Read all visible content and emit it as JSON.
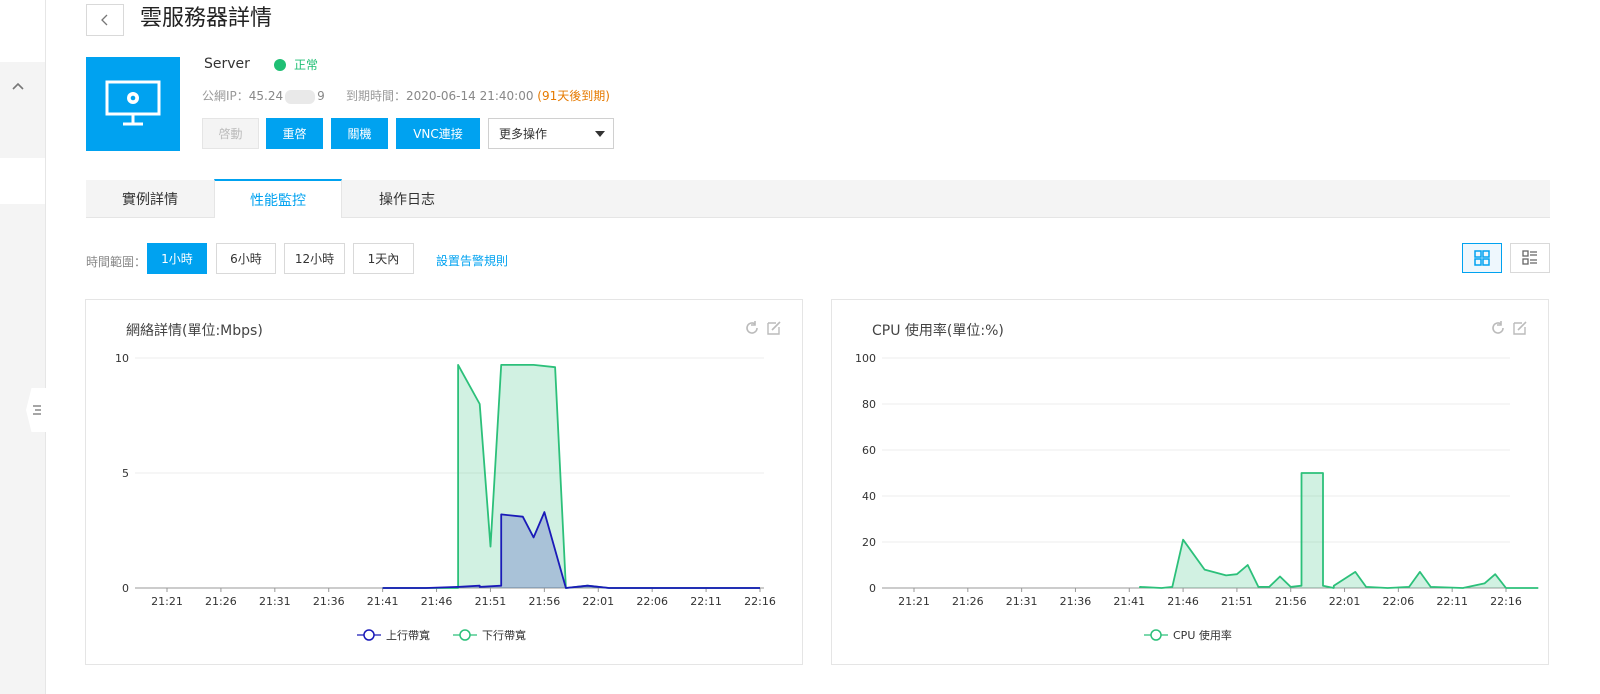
{
  "page": {
    "title": "雲服務器詳情"
  },
  "server": {
    "name": "Server",
    "status": "正常",
    "ip_label": "公網IP：",
    "ip_start": "45.24",
    "ip_end": "9",
    "expire_label": "到期時間：",
    "expire_value": "2020-06-14 21:40:00",
    "expire_note": "(91天後到期)"
  },
  "actions": {
    "start": "啓動",
    "restart": "重啓",
    "shutdown": "關機",
    "vnc": "VNC連接",
    "more": "更多操作"
  },
  "tabs": [
    {
      "label": "實例詳情"
    },
    {
      "label": "性能監控"
    },
    {
      "label": "操作日志"
    }
  ],
  "range": {
    "label": "時間範圍：",
    "options": [
      "1小時",
      "6小時",
      "12小時",
      "1天內"
    ],
    "selected": "1小時",
    "alarm_link": "設置告警規則"
  },
  "colors": {
    "accent": "#00a2f0",
    "green": "#1fbf74",
    "series_up": "#1a1ab8",
    "series_down": "#2cc07a"
  },
  "chart_data": [
    {
      "type": "area",
      "title": "網絡詳情(單位:Mbps)",
      "x": [
        "21:21",
        "21:26",
        "21:31",
        "21:36",
        "21:41",
        "21:46",
        "21:51",
        "21:56",
        "22:01",
        "22:06",
        "22:11",
        "22:16"
      ],
      "ylim": [
        0,
        10
      ],
      "yticks": [
        "10",
        "5",
        "0"
      ],
      "legend_position": "bottom",
      "series": [
        {
          "name": "上行帶寬",
          "color": "#1a1ab8",
          "points": [
            [
              21.41,
              0
            ],
            [
              21.45,
              0
            ],
            [
              21.48,
              0.05
            ],
            [
              21.495,
              0.1
            ],
            [
              21.505,
              0.05
            ],
            [
              21.515,
              0.1
            ],
            [
              21.52,
              2.5
            ],
            [
              21.525,
              3.2
            ],
            [
              21.54,
              3.1
            ],
            [
              21.55,
              2.2
            ],
            [
              21.56,
              3.3
            ],
            [
              21.58,
              0
            ],
            [
              22.0,
              0.1
            ],
            [
              22.02,
              0
            ],
            [
              22.16,
              0
            ]
          ]
        },
        {
          "name": "下行帶寬",
          "color": "#2cc07a",
          "points": [
            [
              21.41,
              0
            ],
            [
              21.475,
              0
            ],
            [
              21.485,
              9.7
            ],
            [
              21.5,
              8
            ],
            [
              21.51,
              1.8
            ],
            [
              21.525,
              9.7
            ],
            [
              21.55,
              9.7
            ],
            [
              21.565,
              9.6
            ],
            [
              21.58,
              0
            ],
            [
              22.0,
              0.1
            ],
            [
              22.02,
              0
            ],
            [
              22.16,
              0
            ]
          ]
        }
      ]
    },
    {
      "type": "area",
      "title": "CPU 使用率(單位:%)",
      "x": [
        "21:21",
        "21:26",
        "21:31",
        "21:36",
        "21:41",
        "21:46",
        "21:51",
        "21:56",
        "22:01",
        "22:06",
        "22:11",
        "22:16"
      ],
      "ylim": [
        0,
        100
      ],
      "yticks": [
        "100",
        "80",
        "60",
        "40",
        "20",
        "0"
      ],
      "legend_position": "bottom",
      "series": [
        {
          "name": "CPU 使用率",
          "color": "#2cc07a",
          "points": [
            [
              21.42,
              0
            ],
            [
              21.42,
              0.5
            ],
            [
              21.44,
              0
            ],
            [
              21.455,
              0.5
            ],
            [
              21.465,
              21
            ],
            [
              21.48,
              8
            ],
            [
              21.5,
              5.5
            ],
            [
              21.51,
              6
            ],
            [
              21.52,
              10
            ],
            [
              21.53,
              0.5
            ],
            [
              21.54,
              0.5
            ],
            [
              21.55,
              5
            ],
            [
              21.56,
              0.5
            ],
            [
              21.565,
              1
            ],
            [
              21.57,
              50
            ],
            [
              21.585,
              50
            ],
            [
              21.595,
              1
            ],
            [
              21.6,
              0
            ],
            [
              22.0,
              1
            ],
            [
              22.015,
              7
            ],
            [
              22.03,
              0.5
            ],
            [
              22.05,
              0
            ],
            [
              22.07,
              0.5
            ],
            [
              22.08,
              7
            ],
            [
              22.095,
              0.5
            ],
            [
              22.12,
              0
            ],
            [
              22.14,
              2
            ],
            [
              22.15,
              6
            ],
            [
              22.165,
              0
            ],
            [
              22.19,
              0
            ]
          ]
        }
      ]
    }
  ]
}
